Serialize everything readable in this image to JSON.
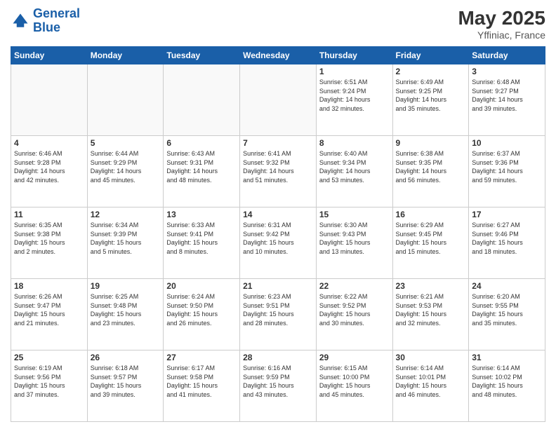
{
  "header": {
    "logo_line1": "General",
    "logo_line2": "Blue",
    "month_title": "May 2025",
    "subtitle": "Yffiniac, France"
  },
  "weekdays": [
    "Sunday",
    "Monday",
    "Tuesday",
    "Wednesday",
    "Thursday",
    "Friday",
    "Saturday"
  ],
  "weeks": [
    [
      {
        "day": "",
        "info": ""
      },
      {
        "day": "",
        "info": ""
      },
      {
        "day": "",
        "info": ""
      },
      {
        "day": "",
        "info": ""
      },
      {
        "day": "1",
        "info": "Sunrise: 6:51 AM\nSunset: 9:24 PM\nDaylight: 14 hours\nand 32 minutes."
      },
      {
        "day": "2",
        "info": "Sunrise: 6:49 AM\nSunset: 9:25 PM\nDaylight: 14 hours\nand 35 minutes."
      },
      {
        "day": "3",
        "info": "Sunrise: 6:48 AM\nSunset: 9:27 PM\nDaylight: 14 hours\nand 39 minutes."
      }
    ],
    [
      {
        "day": "4",
        "info": "Sunrise: 6:46 AM\nSunset: 9:28 PM\nDaylight: 14 hours\nand 42 minutes."
      },
      {
        "day": "5",
        "info": "Sunrise: 6:44 AM\nSunset: 9:29 PM\nDaylight: 14 hours\nand 45 minutes."
      },
      {
        "day": "6",
        "info": "Sunrise: 6:43 AM\nSunset: 9:31 PM\nDaylight: 14 hours\nand 48 minutes."
      },
      {
        "day": "7",
        "info": "Sunrise: 6:41 AM\nSunset: 9:32 PM\nDaylight: 14 hours\nand 51 minutes."
      },
      {
        "day": "8",
        "info": "Sunrise: 6:40 AM\nSunset: 9:34 PM\nDaylight: 14 hours\nand 53 minutes."
      },
      {
        "day": "9",
        "info": "Sunrise: 6:38 AM\nSunset: 9:35 PM\nDaylight: 14 hours\nand 56 minutes."
      },
      {
        "day": "10",
        "info": "Sunrise: 6:37 AM\nSunset: 9:36 PM\nDaylight: 14 hours\nand 59 minutes."
      }
    ],
    [
      {
        "day": "11",
        "info": "Sunrise: 6:35 AM\nSunset: 9:38 PM\nDaylight: 15 hours\nand 2 minutes."
      },
      {
        "day": "12",
        "info": "Sunrise: 6:34 AM\nSunset: 9:39 PM\nDaylight: 15 hours\nand 5 minutes."
      },
      {
        "day": "13",
        "info": "Sunrise: 6:33 AM\nSunset: 9:41 PM\nDaylight: 15 hours\nand 8 minutes."
      },
      {
        "day": "14",
        "info": "Sunrise: 6:31 AM\nSunset: 9:42 PM\nDaylight: 15 hours\nand 10 minutes."
      },
      {
        "day": "15",
        "info": "Sunrise: 6:30 AM\nSunset: 9:43 PM\nDaylight: 15 hours\nand 13 minutes."
      },
      {
        "day": "16",
        "info": "Sunrise: 6:29 AM\nSunset: 9:45 PM\nDaylight: 15 hours\nand 15 minutes."
      },
      {
        "day": "17",
        "info": "Sunrise: 6:27 AM\nSunset: 9:46 PM\nDaylight: 15 hours\nand 18 minutes."
      }
    ],
    [
      {
        "day": "18",
        "info": "Sunrise: 6:26 AM\nSunset: 9:47 PM\nDaylight: 15 hours\nand 21 minutes."
      },
      {
        "day": "19",
        "info": "Sunrise: 6:25 AM\nSunset: 9:48 PM\nDaylight: 15 hours\nand 23 minutes."
      },
      {
        "day": "20",
        "info": "Sunrise: 6:24 AM\nSunset: 9:50 PM\nDaylight: 15 hours\nand 26 minutes."
      },
      {
        "day": "21",
        "info": "Sunrise: 6:23 AM\nSunset: 9:51 PM\nDaylight: 15 hours\nand 28 minutes."
      },
      {
        "day": "22",
        "info": "Sunrise: 6:22 AM\nSunset: 9:52 PM\nDaylight: 15 hours\nand 30 minutes."
      },
      {
        "day": "23",
        "info": "Sunrise: 6:21 AM\nSunset: 9:53 PM\nDaylight: 15 hours\nand 32 minutes."
      },
      {
        "day": "24",
        "info": "Sunrise: 6:20 AM\nSunset: 9:55 PM\nDaylight: 15 hours\nand 35 minutes."
      }
    ],
    [
      {
        "day": "25",
        "info": "Sunrise: 6:19 AM\nSunset: 9:56 PM\nDaylight: 15 hours\nand 37 minutes."
      },
      {
        "day": "26",
        "info": "Sunrise: 6:18 AM\nSunset: 9:57 PM\nDaylight: 15 hours\nand 39 minutes."
      },
      {
        "day": "27",
        "info": "Sunrise: 6:17 AM\nSunset: 9:58 PM\nDaylight: 15 hours\nand 41 minutes."
      },
      {
        "day": "28",
        "info": "Sunrise: 6:16 AM\nSunset: 9:59 PM\nDaylight: 15 hours\nand 43 minutes."
      },
      {
        "day": "29",
        "info": "Sunrise: 6:15 AM\nSunset: 10:00 PM\nDaylight: 15 hours\nand 45 minutes."
      },
      {
        "day": "30",
        "info": "Sunrise: 6:14 AM\nSunset: 10:01 PM\nDaylight: 15 hours\nand 46 minutes."
      },
      {
        "day": "31",
        "info": "Sunrise: 6:14 AM\nSunset: 10:02 PM\nDaylight: 15 hours\nand 48 minutes."
      }
    ]
  ]
}
